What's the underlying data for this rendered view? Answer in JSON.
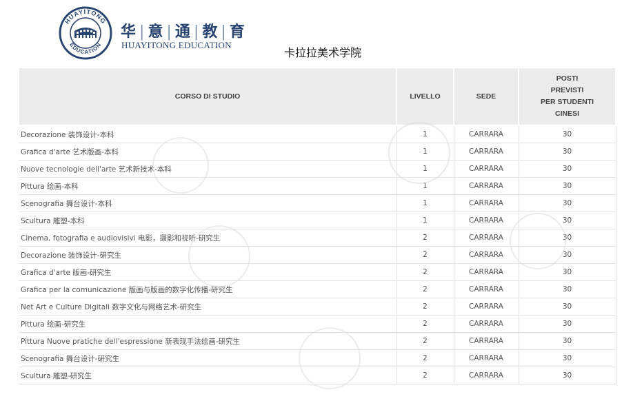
{
  "header": {
    "logo_seal_text": "HUAYITONG EDUCATION",
    "brand_cn": [
      "华",
      "意",
      "通",
      "教",
      "育"
    ],
    "brand_en": "HUAYITONG EDUCATION",
    "school_name": "卡拉拉美术学院"
  },
  "table": {
    "columns": [
      "CORSO DI STUDIO",
      "LIVELLO",
      "SEDE",
      "POSTI\nPREVISTI\nPER STUDENTI\nCINESI"
    ],
    "rows": [
      {
        "course": "Decorazione 装饰设计-本科",
        "level": "1",
        "seat": "CARRARA",
        "posti": "30"
      },
      {
        "course": "Grafica d'arte 艺术版画-本科",
        "level": "1",
        "seat": "CARRARA",
        "posti": "30"
      },
      {
        "course": "Nuove tecnologie dell'arte 艺术新技术-本科",
        "level": "1",
        "seat": "CARRARA",
        "posti": "30"
      },
      {
        "course": "Pittura 绘画-本科",
        "level": "1",
        "seat": "CARRARA",
        "posti": "30"
      },
      {
        "course": "Scenografia 舞台设计-本科",
        "level": "1",
        "seat": "CARRARA",
        "posti": "30"
      },
      {
        "course": "Scultura 雕塑-本科",
        "level": "1",
        "seat": "CARRARA",
        "posti": "30"
      },
      {
        "course": "Cinema, fotografia e audiovisivi 电影，摄影和视听-研究生",
        "level": "2",
        "seat": "CARRARA",
        "posti": "30"
      },
      {
        "course": "Decorazione 装饰设计-研究生",
        "level": "2",
        "seat": "CARRARA",
        "posti": "30"
      },
      {
        "course": "Grafica d'arte 版画-研究生",
        "level": "2",
        "seat": "CARRARA",
        "posti": "30"
      },
      {
        "course": "Grafica per la comunicazione 版画与版画的数字化传播-研究生",
        "level": "2",
        "seat": "CARRARA",
        "posti": "30"
      },
      {
        "course": "Net Art e Culture Digitali 数字文化与网络艺术-研究生",
        "level": "2",
        "seat": "CARRARA",
        "posti": "30"
      },
      {
        "course": "Pittura 绘画-研究生",
        "level": "2",
        "seat": "CARRARA",
        "posti": "30"
      },
      {
        "course": "Pittura Nuove pratiche dell'espressione 新表现手法绘画-研究生",
        "level": "2",
        "seat": "CARRARA",
        "posti": "30"
      },
      {
        "course": "Scenografia 舞台设计-研究生",
        "level": "2",
        "seat": "CARRARA",
        "posti": "30"
      },
      {
        "course": "Scultura 雕塑-研究生",
        "level": "2",
        "seat": "CARRARA",
        "posti": "30"
      }
    ]
  },
  "colors": {
    "brand_blue": "#27436f",
    "header_bg": "#ececec",
    "grid_line": "#e2e2e2",
    "watermark": "#d9d9d9"
  }
}
